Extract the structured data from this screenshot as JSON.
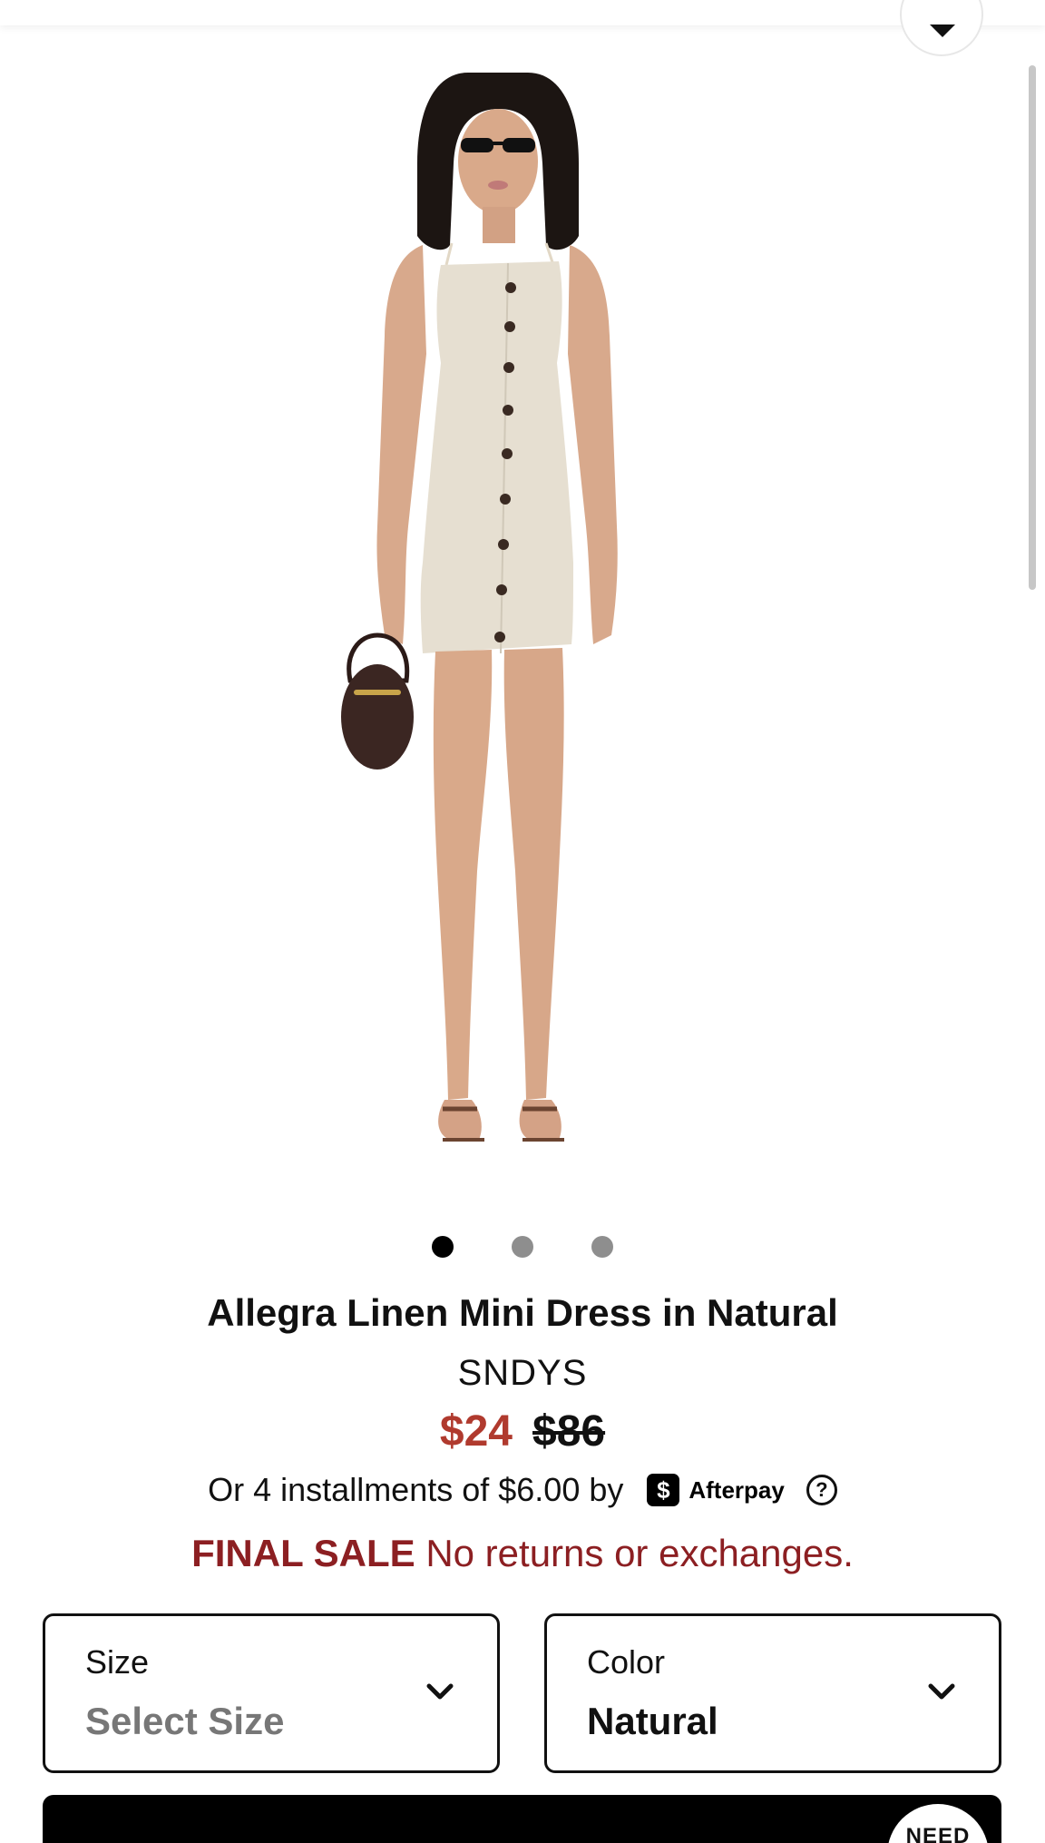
{
  "product": {
    "title": "Allegra Linen Mini Dress in Natural",
    "brand": "SNDYS",
    "sale_price": "$24",
    "original_price": "$86"
  },
  "carousel": {
    "slide_count": 3,
    "active_index": 0
  },
  "installments": {
    "text": "Or 4 installments of $6.00 by",
    "provider_mark": "$",
    "provider_name": "Afterpay",
    "help_glyph": "?"
  },
  "final_sale": {
    "label": "FINAL SALE",
    "message": "No returns or exchanges."
  },
  "size_selector": {
    "label": "Size",
    "value": "Select Size"
  },
  "color_selector": {
    "label": "Color",
    "value": "Natural"
  },
  "help_button": {
    "label": "NEED"
  },
  "colors": {
    "sale_price": "#b03a2e",
    "final_sale": "#8c1f22",
    "dress": "#e6dfd1",
    "skin": "#dcae90",
    "hair": "#1c1512",
    "bag": "#3b2622",
    "button": "#3a2a22"
  },
  "icons": {
    "top_button": "chevron-down-icon",
    "select_arrow": "chevron-down-icon",
    "help": "question-circle-icon",
    "payment": "afterpay-logo-icon"
  }
}
